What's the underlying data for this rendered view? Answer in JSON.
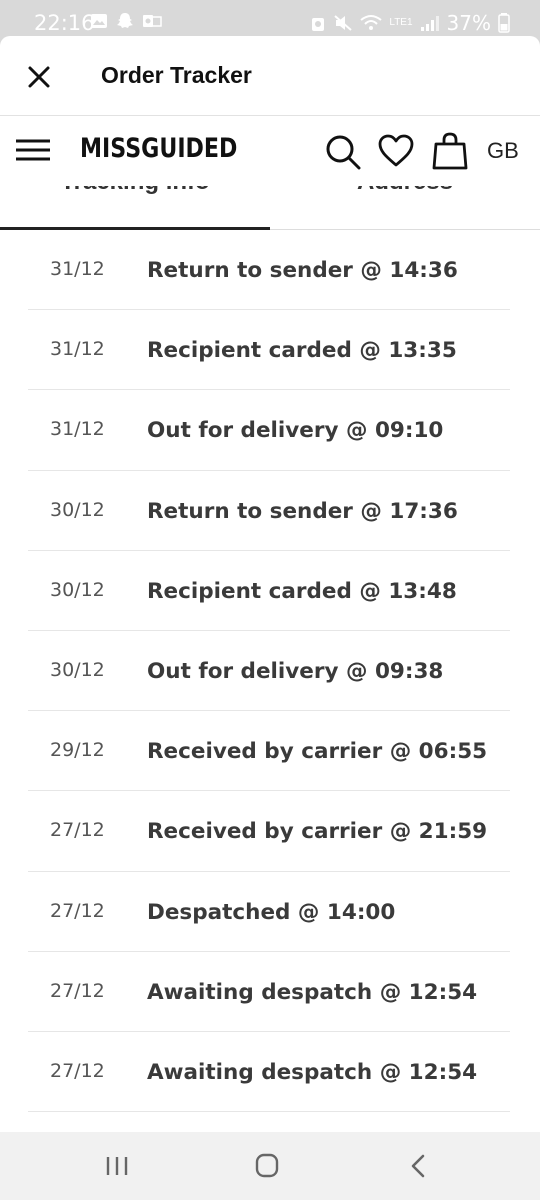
{
  "status_bar": {
    "time": "22:16",
    "battery": "37%",
    "network": "LTE1"
  },
  "header": {
    "title": "Order Tracker"
  },
  "site": {
    "logo": "MISSGUIDED",
    "region": "GB"
  },
  "tabs": [
    {
      "label": "Tracking info"
    },
    {
      "label": "Address"
    }
  ],
  "events": [
    {
      "date": "31/12",
      "description": "Return to sender @ 14:36"
    },
    {
      "date": "31/12",
      "description": "Recipient carded @ 13:35"
    },
    {
      "date": "31/12",
      "description": "Out for delivery @ 09:10"
    },
    {
      "date": "30/12",
      "description": "Return to sender @ 17:36"
    },
    {
      "date": "30/12",
      "description": "Recipient carded @ 13:48"
    },
    {
      "date": "30/12",
      "description": "Out for delivery @ 09:38"
    },
    {
      "date": "29/12",
      "description": "Received by carrier @ 06:55"
    },
    {
      "date": "27/12",
      "description": "Received by carrier @ 21:59"
    },
    {
      "date": "27/12",
      "description": "Despatched @ 14:00"
    },
    {
      "date": "27/12",
      "description": "Awaiting despatch @ 12:54"
    },
    {
      "date": "27/12",
      "description": "Awaiting despatch @ 12:54"
    }
  ]
}
